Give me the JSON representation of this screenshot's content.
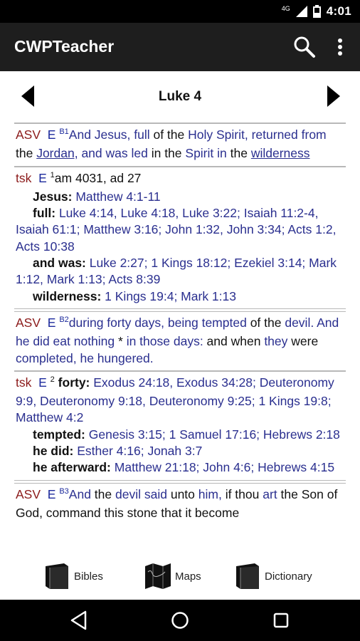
{
  "status": {
    "network": "4G",
    "time": "4:01"
  },
  "app": {
    "title": "CWPTeacher"
  },
  "chapter": {
    "title": "Luke 4"
  },
  "verse1": {
    "src": "ASV",
    "e": "E",
    "b": "B",
    "num": "1",
    "text": [
      {
        "t": "And Jesus, full",
        "c": "blue"
      },
      {
        "t": " of the ",
        "c": ""
      },
      {
        "t": "Holy Spirit,",
        "c": "blue"
      },
      {
        "t": " returned from",
        "c": "blue"
      },
      {
        "t": " the ",
        "c": ""
      },
      {
        "t": "Jordan,",
        "c": "blue u"
      },
      {
        "t": " and was led",
        "c": "blue"
      },
      {
        "t": " in the ",
        "c": ""
      },
      {
        "t": "Spirit",
        "c": "blue"
      },
      {
        "t": " in",
        "c": "blue"
      },
      {
        "t": " the ",
        "c": ""
      },
      {
        "t": "wilderness",
        "c": "blue u"
      }
    ]
  },
  "tsk1": {
    "src": "tsk",
    "e": "E",
    "num": "1",
    "date": "am 4031, ad 27",
    "entries": [
      {
        "key": "Jesus:",
        "refs": " Matthew 4:1-11"
      },
      {
        "key": "full:",
        "refs": " Luke 4:14, Luke 4:18, Luke 3:22; Isaiah 11:2-4, Isaiah 61:1; Matthew 3:16; John 1:32, John 3:34; Acts 1:2, Acts 10:38"
      },
      {
        "key": "and was:",
        "refs": " Luke 2:27; 1 Kings 18:12; Ezekiel 3:14; Mark 1:12, Mark 1:13; Acts 8:39"
      },
      {
        "key": "wilderness:",
        "refs": " 1 Kings 19:4; Mark 1:13"
      }
    ]
  },
  "verse2": {
    "src": "ASV",
    "e": "E",
    "b": "B",
    "num": "2",
    "text": [
      {
        "t": "during forty days,",
        "c": "blue"
      },
      {
        "t": " ",
        "c": ""
      },
      {
        "t": "being tempted",
        "c": "blue"
      },
      {
        "t": " of the ",
        "c": ""
      },
      {
        "t": "devil.",
        "c": "blue"
      },
      {
        "t": " And he did eat ",
        "c": "blue"
      },
      {
        "t": "nothing",
        "c": "blue"
      },
      {
        "t": " * ",
        "c": ""
      },
      {
        "t": "in those days:",
        "c": "blue"
      },
      {
        "t": " and when ",
        "c": ""
      },
      {
        "t": "they",
        "c": "blue"
      },
      {
        "t": " were ",
        "c": ""
      },
      {
        "t": "completed,",
        "c": "blue"
      },
      {
        "t": " ",
        "c": ""
      },
      {
        "t": "he hungered.",
        "c": "blue"
      }
    ]
  },
  "tsk2": {
    "src": "tsk",
    "e": "E",
    "num": "2",
    "first": {
      "key": "forty:",
      "refs": " Exodus 24:18, Exodus 34:28; Deuteronomy 9:9, Deuteronomy 9:18, Deuteronomy 9:25; 1 Kings 19:8; Matthew 4:2"
    },
    "entries": [
      {
        "key": "tempted:",
        "refs": " Genesis 3:15; 1 Samuel 17:16; Hebrews 2:18"
      },
      {
        "key": "he did:",
        "refs": " Esther 4:16; Jonah 3:7"
      },
      {
        "key": "he afterward:",
        "refs": " Matthew 21:18; John 4:6; Hebrews 4:15"
      }
    ]
  },
  "verse3": {
    "src": "ASV",
    "e": "E",
    "b": "B",
    "num": "3",
    "text": [
      {
        "t": "And",
        "c": "blue"
      },
      {
        "t": " the ",
        "c": ""
      },
      {
        "t": "devil",
        "c": "blue"
      },
      {
        "t": " said",
        "c": "blue"
      },
      {
        "t": " unto ",
        "c": ""
      },
      {
        "t": "him,",
        "c": "blue"
      },
      {
        "t": " if thou ",
        "c": ""
      },
      {
        "t": "art",
        "c": "blue"
      },
      {
        "t": " the Son of God, command this stone that it become",
        "c": ""
      }
    ]
  },
  "toolbar": {
    "bibles": "Bibles",
    "maps": "Maps",
    "dictionary": "Dictionary"
  }
}
